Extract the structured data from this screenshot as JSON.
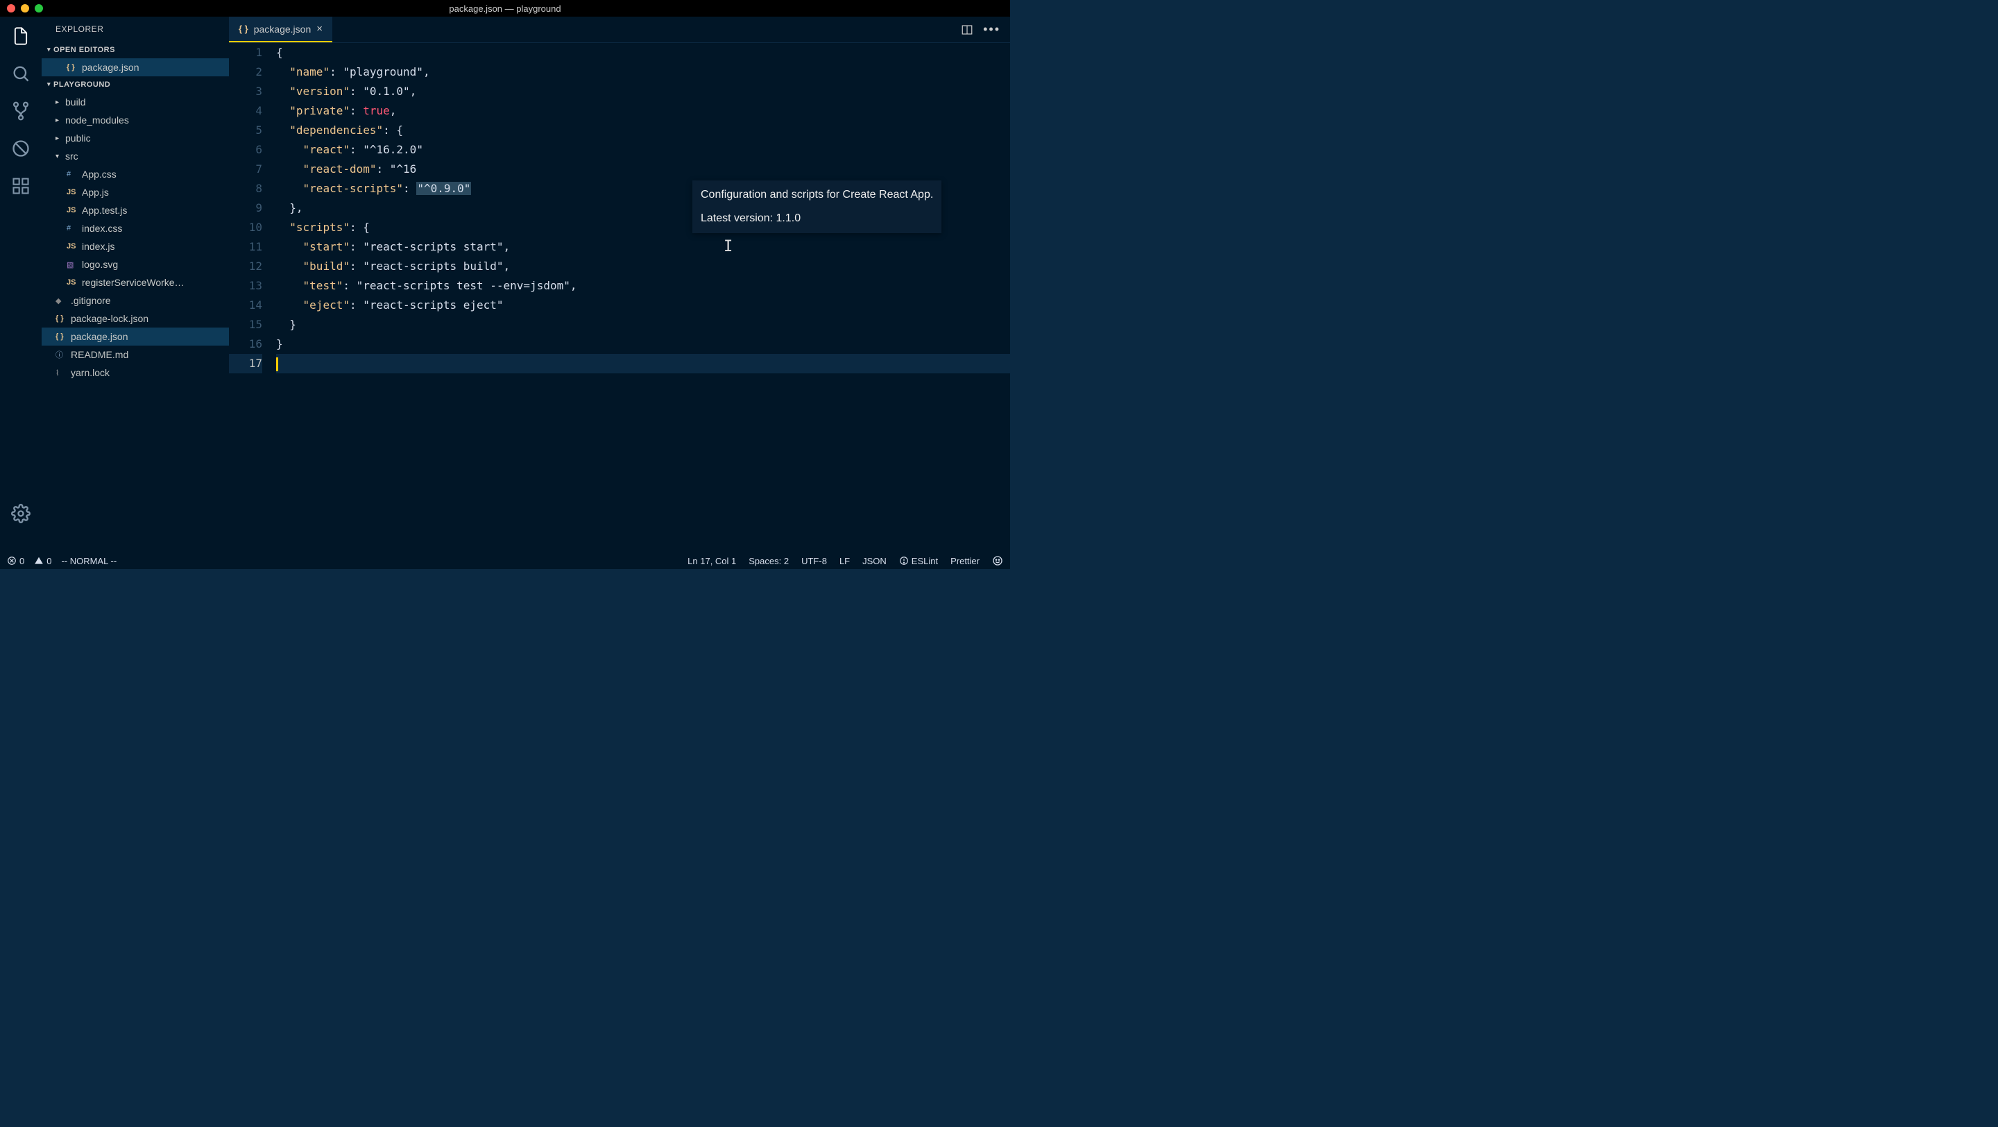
{
  "window": {
    "title": "package.json — playground"
  },
  "sidebar": {
    "title": "EXPLORER",
    "sections": {
      "open_editors": {
        "label": "OPEN EDITORS",
        "items": [
          {
            "label": "package.json",
            "iconcls": "json",
            "iconglyph": "{ }"
          }
        ]
      },
      "project": {
        "label": "PLAYGROUND",
        "items": [
          {
            "label": "build",
            "kind": "folder"
          },
          {
            "label": "node_modules",
            "kind": "folder"
          },
          {
            "label": "public",
            "kind": "folder"
          },
          {
            "label": "src",
            "kind": "folder",
            "open": true
          },
          {
            "label": "App.css",
            "kind": "file",
            "iconcls": "hash",
            "iconglyph": "#",
            "indent": 2
          },
          {
            "label": "App.js",
            "kind": "file",
            "iconcls": "js",
            "iconglyph": "JS",
            "indent": 2
          },
          {
            "label": "App.test.js",
            "kind": "file",
            "iconcls": "js",
            "iconglyph": "JS",
            "indent": 2
          },
          {
            "label": "index.css",
            "kind": "file",
            "iconcls": "hash",
            "iconglyph": "#",
            "indent": 2
          },
          {
            "label": "index.js",
            "kind": "file",
            "iconcls": "js",
            "iconglyph": "JS",
            "indent": 2
          },
          {
            "label": "logo.svg",
            "kind": "file",
            "iconcls": "svg",
            "iconglyph": "▧",
            "indent": 2
          },
          {
            "label": "registerServiceWorke…",
            "kind": "file",
            "iconcls": "js",
            "iconglyph": "JS",
            "indent": 2
          },
          {
            "label": ".gitignore",
            "kind": "file",
            "iconcls": "git",
            "iconglyph": "◆",
            "indent": 1
          },
          {
            "label": "package-lock.json",
            "kind": "file",
            "iconcls": "json",
            "iconglyph": "{ }",
            "indent": 1
          },
          {
            "label": "package.json",
            "kind": "file",
            "iconcls": "json",
            "iconglyph": "{ }",
            "indent": 1,
            "selected": true
          },
          {
            "label": "README.md",
            "kind": "file",
            "iconcls": "info",
            "iconglyph": "ⓘ",
            "indent": 1
          },
          {
            "label": "yarn.lock",
            "kind": "file",
            "iconcls": "lock",
            "iconglyph": "⌇",
            "indent": 1
          }
        ]
      }
    }
  },
  "tab": {
    "label": "package.json",
    "iconglyph": "{ }"
  },
  "editor": {
    "lines": [
      1,
      2,
      3,
      4,
      5,
      6,
      7,
      8,
      9,
      10,
      11,
      12,
      13,
      14,
      15,
      16,
      17
    ],
    "json": {
      "name_key": "name",
      "name_val": "playground",
      "version_key": "version",
      "version_val": "0.1.0",
      "private_key": "private",
      "private_val": "true",
      "deps_key": "dependencies",
      "react_key": "react",
      "react_val": "^16.2.0",
      "reactdom_key": "react-dom",
      "reactdom_val": "^16",
      "reactscripts_key": "react-scripts",
      "reactscripts_val": "^0.9.0",
      "scripts_key": "scripts",
      "start_key": "start",
      "start_val": "react-scripts start",
      "build_key": "build",
      "build_val": "react-scripts build",
      "test_key": "test",
      "test_val": "react-scripts test --env=jsdom",
      "eject_key": "eject",
      "eject_val": "react-scripts eject"
    },
    "current_line": 17
  },
  "tooltip": {
    "line1": "Configuration and scripts for Create React App.",
    "line2": "Latest version: 1.1.0"
  },
  "status": {
    "errors": "0",
    "warnings": "0",
    "mode": "-- NORMAL --",
    "position": "Ln 17, Col 1",
    "spaces": "Spaces: 2",
    "encoding": "UTF-8",
    "eol": "LF",
    "lang": "JSON",
    "eslint": "ESLint",
    "prettier": "Prettier"
  }
}
